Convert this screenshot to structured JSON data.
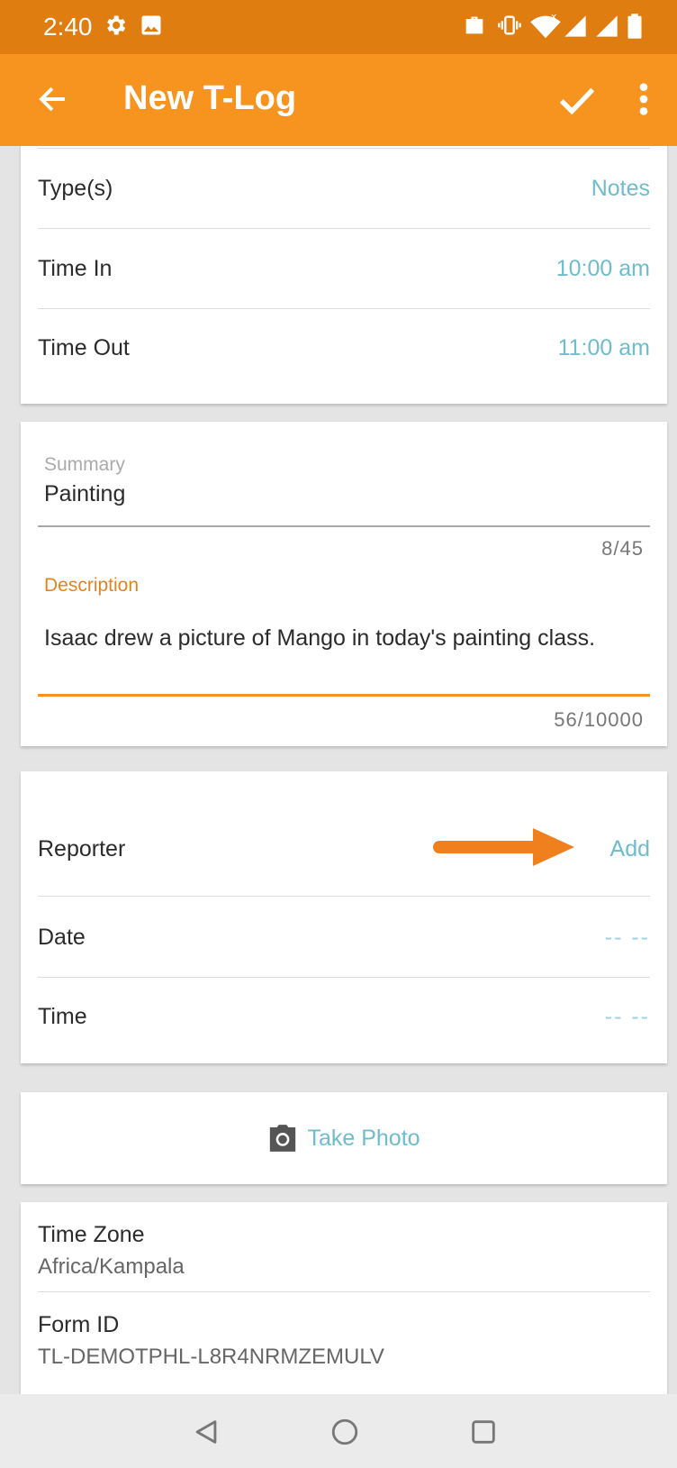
{
  "status_bar": {
    "time": "2:40"
  },
  "app_bar": {
    "title": "New T-Log"
  },
  "details": {
    "types_label": "Type(s)",
    "types_value": "Notes",
    "time_in_label": "Time In",
    "time_in_value": "10:00 am",
    "time_out_label": "Time Out",
    "time_out_value": "11:00 am"
  },
  "summary": {
    "label": "Summary",
    "value": "Painting",
    "counter": "8/45"
  },
  "description": {
    "label": "Description",
    "value": "Isaac drew a picture of Mango in today's painting class.",
    "counter": "56/10000"
  },
  "reporter": {
    "reporter_label": "Reporter",
    "reporter_action": "Add",
    "date_label": "Date",
    "date_value": "-- --",
    "time_label": "Time",
    "time_value": "-- --"
  },
  "photo": {
    "label": "Take Photo"
  },
  "info": {
    "timezone_label": "Time Zone",
    "timezone_value": "Africa/Kampala",
    "form_id_label": "Form ID",
    "form_id_value": "TL-DEMOTPHL-L8R4NRMZEMULV"
  },
  "colors": {
    "accent": "#f7941f",
    "status": "#e07d10",
    "link": "#6ebccc"
  }
}
